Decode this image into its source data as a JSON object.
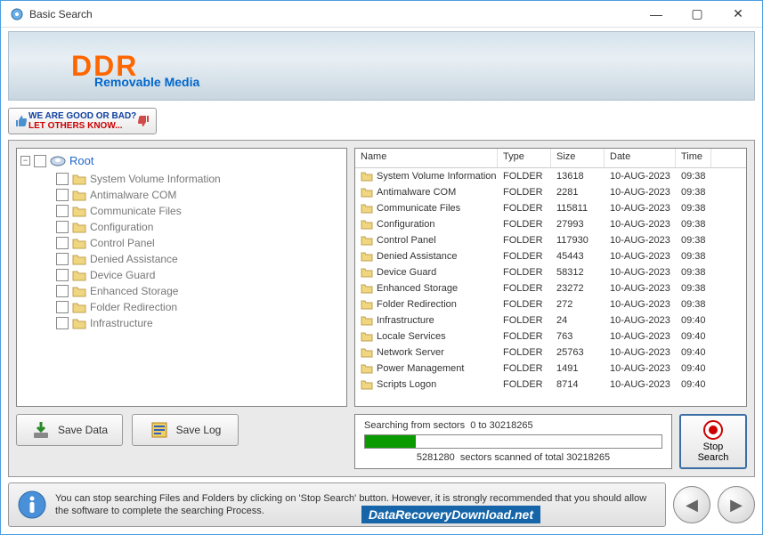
{
  "window": {
    "title": "Basic Search"
  },
  "banner": {
    "logo": "DDR",
    "subtitle": "Removable Media"
  },
  "feedback": {
    "line1": "WE ARE GOOD OR BAD?",
    "line2": "LET OTHERS KNOW..."
  },
  "tree": {
    "root": "Root",
    "items": [
      "System Volume Information",
      "Antimalware COM",
      "Communicate Files",
      "Configuration",
      "Control Panel",
      "Denied Assistance",
      "Device Guard",
      "Enhanced Storage",
      "Folder Redirection",
      "Infrastructure"
    ]
  },
  "list": {
    "columns": {
      "name": "Name",
      "type": "Type",
      "size": "Size",
      "date": "Date",
      "time": "Time"
    },
    "rows": [
      {
        "name": "System Volume Information",
        "type": "FOLDER",
        "size": "13618",
        "date": "10-AUG-2023",
        "time": "09:38"
      },
      {
        "name": "Antimalware COM",
        "type": "FOLDER",
        "size": "2281",
        "date": "10-AUG-2023",
        "time": "09:38"
      },
      {
        "name": "Communicate Files",
        "type": "FOLDER",
        "size": "115811",
        "date": "10-AUG-2023",
        "time": "09:38"
      },
      {
        "name": "Configuration",
        "type": "FOLDER",
        "size": "27993",
        "date": "10-AUG-2023",
        "time": "09:38"
      },
      {
        "name": "Control Panel",
        "type": "FOLDER",
        "size": "117930",
        "date": "10-AUG-2023",
        "time": "09:38"
      },
      {
        "name": "Denied Assistance",
        "type": "FOLDER",
        "size": "45443",
        "date": "10-AUG-2023",
        "time": "09:38"
      },
      {
        "name": "Device Guard",
        "type": "FOLDER",
        "size": "58312",
        "date": "10-AUG-2023",
        "time": "09:38"
      },
      {
        "name": "Enhanced Storage",
        "type": "FOLDER",
        "size": "23272",
        "date": "10-AUG-2023",
        "time": "09:38"
      },
      {
        "name": "Folder Redirection",
        "type": "FOLDER",
        "size": "272",
        "date": "10-AUG-2023",
        "time": "09:38"
      },
      {
        "name": "Infrastructure",
        "type": "FOLDER",
        "size": "24",
        "date": "10-AUG-2023",
        "time": "09:40"
      },
      {
        "name": "Locale Services",
        "type": "FOLDER",
        "size": "763",
        "date": "10-AUG-2023",
        "time": "09:40"
      },
      {
        "name": "Network Server",
        "type": "FOLDER",
        "size": "25763",
        "date": "10-AUG-2023",
        "time": "09:40"
      },
      {
        "name": "Power Management",
        "type": "FOLDER",
        "size": "1491",
        "date": "10-AUG-2023",
        "time": "09:40"
      },
      {
        "name": "Scripts Logon",
        "type": "FOLDER",
        "size": "8714",
        "date": "10-AUG-2023",
        "time": "09:40"
      }
    ]
  },
  "buttons": {
    "save_data": "Save Data",
    "save_log": "Save Log",
    "stop": "Stop\nSearch"
  },
  "progress": {
    "label_prefix": "Searching from sectors",
    "range": "0 to 30218265",
    "scanned": "5281280",
    "total": "30218265",
    "stats_mid": "sectors scanned of total",
    "percent": 17
  },
  "info": {
    "text": "You can stop searching Files and Folders by clicking on 'Stop Search' button. However, it is strongly recommended that you should allow the software to complete the searching Process."
  },
  "watermark": "DataRecoveryDownload.net"
}
